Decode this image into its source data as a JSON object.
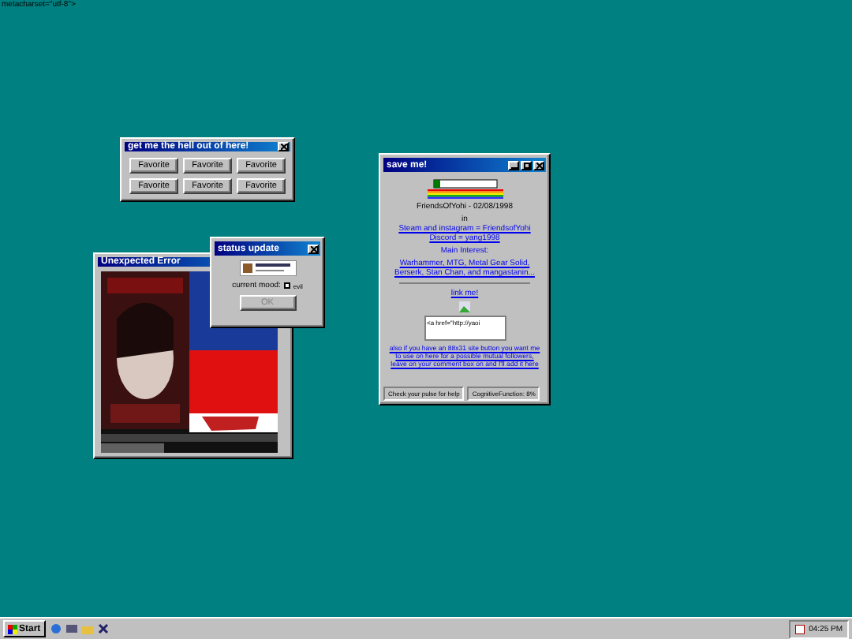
{
  "stray_text": "metacharset=\"utf-8\">",
  "windows": [
    {
      "kind": "favorites",
      "title": "get me the hell out of here!",
      "buttons": [
        "Favorite",
        "Favorite",
        "Favorite",
        "Favorite",
        "Favorite",
        "Favorite"
      ]
    },
    {
      "kind": "error",
      "title": "Unexpected Error"
    },
    {
      "kind": "status",
      "title": "status update",
      "mood_label": "current mood:",
      "mood": "evil",
      "button": {
        "label": "OK",
        "disabled": true
      }
    },
    {
      "kind": "profile",
      "title": "save me!",
      "name_line": "FriendsOfYohi - 02/08/1998",
      "social_prefix": "in",
      "social_link": "Steam and instagram = FriendsofYohi Discord = yang1998",
      "interest_title": "Main Interest:",
      "interests": "Warhammer, MTG, Metal Gear Solid, Berserk, Stan Chan, and mangastanin...",
      "link_me": "link me!",
      "code": "<a href=\"http://yaoi",
      "note": "also if you have an 88x31 site button you want me to use on here for a possible mutual followers, leave on your comment box on and I'll add it here",
      "status": [
        "Check your pulse for help",
        "CognitiveFunction: 8%"
      ]
    }
  ],
  "taskbar": {
    "start": "Start",
    "clock": "04:25 PM"
  }
}
